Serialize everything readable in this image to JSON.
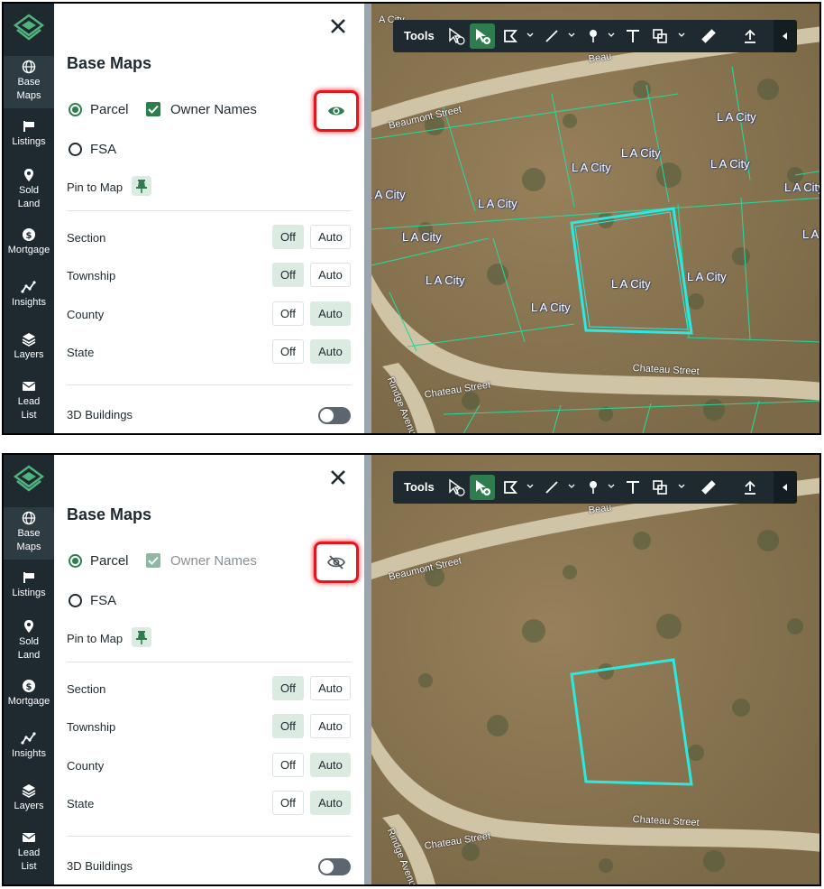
{
  "nav": {
    "items": [
      {
        "icon": "globe-icon",
        "label1": "Base",
        "label2": "Maps"
      },
      {
        "icon": "flag-icon",
        "label1": "Listings",
        "label2": ""
      },
      {
        "icon": "map-pin-icon",
        "label1": "Sold",
        "label2": "Land"
      },
      {
        "icon": "dollar-icon",
        "label1": "Mortgage",
        "label2": ""
      },
      {
        "icon": "insights-icon",
        "label1": "Insights",
        "label2": ""
      },
      {
        "icon": "layers-icon",
        "label1": "Layers",
        "label2": ""
      },
      {
        "icon": "envelope-icon",
        "label1": "Lead",
        "label2": "List"
      }
    ]
  },
  "panel": {
    "title": "Base Maps",
    "parcel_label": "Parcel",
    "owner_names_label": "Owner Names",
    "fsa_label": "FSA",
    "pin_to_map_label": "Pin to Map",
    "rows": [
      {
        "label": "Section",
        "off": "Off",
        "auto": "Auto",
        "selected": "off"
      },
      {
        "label": "Township",
        "off": "Off",
        "auto": "Auto",
        "selected": "off"
      },
      {
        "label": "County",
        "off": "Off",
        "auto": "Auto",
        "selected": "auto"
      },
      {
        "label": "State",
        "off": "Off",
        "auto": "Auto",
        "selected": "auto"
      }
    ],
    "buildings_label": "3D Buildings",
    "buildings_enabled": false
  },
  "toolbar": {
    "label": "Tools"
  },
  "map": {
    "streets": {
      "beaumont": "Beaumont Street",
      "chateau_left": "Chateau Street",
      "chateau_right": "Chateau Street",
      "rindge": "Rindge Avenue",
      "top_partial": "Beau",
      "top_left_partial": "A City"
    },
    "parcel_label_text": "L A City",
    "highlight_color": "#2ee8e0",
    "parcel_line_color": "#2bd49a"
  },
  "states": [
    {
      "name": "owner-names-visible",
      "owner_names_visible": true,
      "eye_icon": "eye-icon"
    },
    {
      "name": "owner-names-hidden",
      "owner_names_visible": false,
      "eye_icon": "eye-off-icon"
    }
  ],
  "colors": {
    "brand_green": "#2e7d4f",
    "nav_bg": "#1e2a30",
    "alert_red": "#e8141a",
    "selected_bg": "#dcebe1"
  }
}
